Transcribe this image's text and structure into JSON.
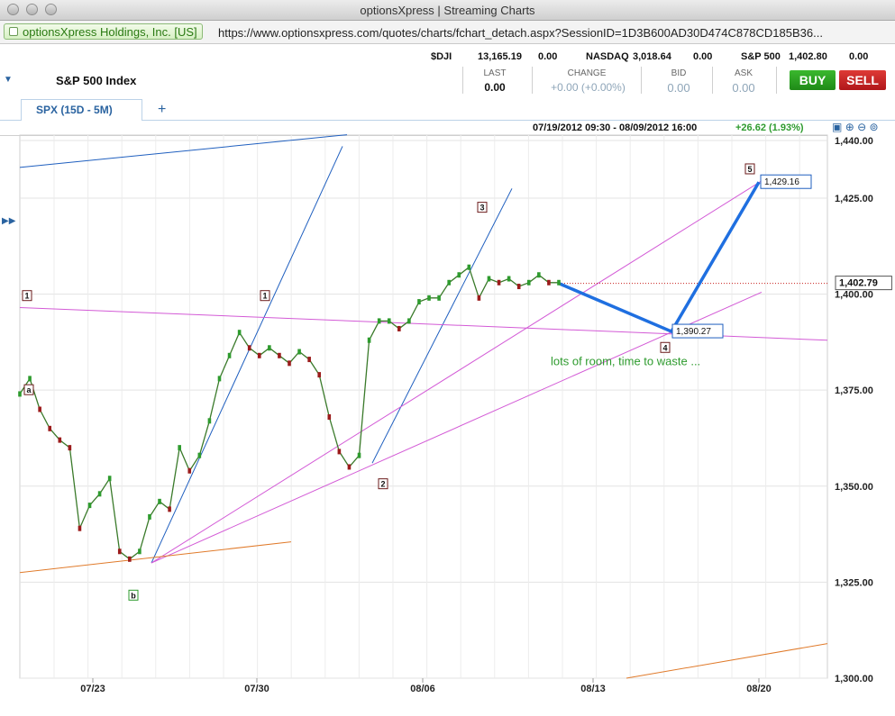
{
  "window": {
    "title": "optionsXpress | Streaming Charts",
    "site_identity": "optionsXpress Holdings, Inc. [US]",
    "url": "https://www.optionsxpress.com/quotes/charts/fchart_detach.aspx?SessionID=1D3B600AD30D474C878CD185B36..."
  },
  "header": {
    "index_title": "S&P 500 Index",
    "tickers": [
      {
        "symbol": "$DJI",
        "value": "13,165.19",
        "change": "0.00"
      },
      {
        "symbol": "NASDAQ",
        "value": "3,018.64",
        "change": "0.00"
      },
      {
        "symbol": "S&P 500",
        "value": "1,402.80",
        "change": "0.00"
      }
    ],
    "quote": {
      "last_label": "LAST",
      "last_value": "0.00",
      "change_label": "CHANGE",
      "change_value": "+0.00 (+0.00%)",
      "bid_label": "BID",
      "bid_value": "0.00",
      "ask_label": "ASK",
      "ask_value": "0.00"
    },
    "buy_label": "BUY",
    "sell_label": "SELL"
  },
  "tabs": [
    {
      "label": "SPX (15D - 5M)"
    }
  ],
  "chart_header": {
    "range": "07/19/2012 09:30 - 08/09/2012 16:00",
    "change": "+26.62 (1.93%)"
  },
  "icons": [
    "expand-icon",
    "collapse-side-icon",
    "fit-icon",
    "zoom-in-icon",
    "zoom-out-icon",
    "zoom-reset-icon",
    "add-tab-icon"
  ],
  "colors": {
    "buy": "#2a9a1f",
    "sell": "#c8201f",
    "up": "#2e9b2e",
    "down": "#9b1b1b",
    "trend_blue": "#1f5fbf",
    "magenta": "#d35ad6",
    "orange": "#e07a2a"
  },
  "chart_data": {
    "type": "line",
    "title": "SPX (15D - 5M)",
    "x_ticks": [
      "07/23",
      "07/30",
      "08/06",
      "08/13",
      "08/20"
    ],
    "y_ticks": [
      "1,440.00",
      "1,425.00",
      "1,400.00",
      "1,375.00",
      "1,350.00",
      "1,325.00",
      "1,300.00"
    ],
    "ylim": [
      1300,
      1440
    ],
    "price_label": "1,402.79",
    "projection": [
      {
        "label": "1,390.27",
        "value": 1390.27
      },
      {
        "label": "1,429.16",
        "value": 1429.16
      }
    ],
    "wave_labels": [
      "1",
      "1",
      "2",
      "3",
      "4",
      "5",
      "a",
      "b"
    ],
    "annotation": "lots of room, time to waste ...",
    "series": [
      {
        "values": [
          1374,
          1378,
          1370,
          1365,
          1362,
          1360,
          1339,
          1345,
          1348,
          1352,
          1333,
          1331,
          1333,
          1342,
          1346,
          1344,
          1360,
          1354,
          1358,
          1367,
          1378,
          1384,
          1390,
          1386,
          1384,
          1386,
          1384,
          1382,
          1385,
          1383,
          1379,
          1368,
          1359,
          1355,
          1358,
          1388,
          1393,
          1393,
          1391,
          1393,
          1398,
          1399,
          1399,
          1403,
          1405,
          1407,
          1399,
          1404,
          1403,
          1404,
          1402,
          1403,
          1405,
          1403,
          1403
        ]
      }
    ]
  }
}
